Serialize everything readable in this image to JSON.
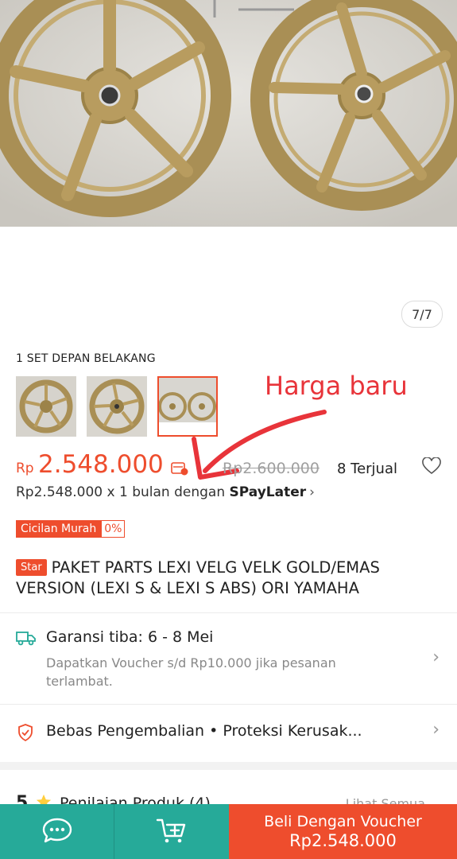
{
  "product": {
    "image_counter": "7/7",
    "variant_label": "1 SET DEPAN BELAKANG",
    "price_currency": "Rp",
    "price_value": "2.548.000",
    "price_old": "Rp2.600.000",
    "sold": "8 Terjual",
    "spaylater_prefix": "Rp2.548.000 x 1 bulan dengan ",
    "spaylater_brand": "SPayLater",
    "installment_label": "Cicilan Murah",
    "installment_rate": "0%",
    "star_tag": "Star",
    "title": "PAKET PARTS LEXI VELG VELK GOLD/EMAS VERSION (LEXI S & LEXI S ABS) ORI YAMAHA"
  },
  "annotation": {
    "text": "Harga baru",
    "color": "#e8343a"
  },
  "shipping": {
    "title": "Garansi tiba: 6 - 8 Mei",
    "subtitle": "Dapatkan Voucher s/d Rp10.000 jika pesanan terlambat."
  },
  "returns": {
    "text": "Bebas Pengembalian  •  Proteksi Kerusak..."
  },
  "reviews": {
    "score": "5",
    "title": "Penilaian Produk (4)",
    "more": "Lihat Semua"
  },
  "bottom_bar": {
    "buy_label": "Beli Dengan Voucher",
    "buy_price": "Rp2.548.000"
  },
  "colors": {
    "accent": "#ee4d2d",
    "teal": "#26aa99"
  },
  "icons": [
    "chat-icon",
    "add-to-cart-icon",
    "truck-icon",
    "shield-icon",
    "heart-icon",
    "star-icon",
    "chevron-right-icon",
    "paylater-icon"
  ]
}
